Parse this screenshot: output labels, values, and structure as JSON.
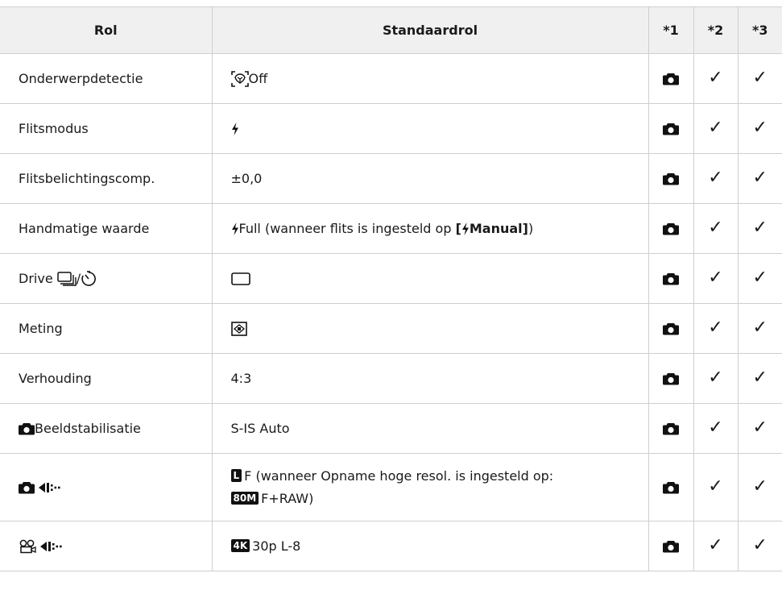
{
  "header": {
    "rol": "Rol",
    "standaard": "Standaardrol",
    "n1": "*1",
    "n2": "*2",
    "n3": "*3"
  },
  "check": "✓",
  "rows": [
    {
      "rol": "Onderwerpdetectie",
      "value": "Off"
    },
    {
      "rol": "Flitsmodus",
      "value": ""
    },
    {
      "rol": "Flitsbelichtingscomp.",
      "value": "±0,0"
    },
    {
      "rol": "Handmatige waarde",
      "value_pre": "Full (wanneer flits is ingesteld op ",
      "value_bold": "[",
      "value_bold2": "Manual]",
      "value_post": ")"
    },
    {
      "rol": "Drive ",
      "rol_sep": "/",
      "value": ""
    },
    {
      "rol": "Meting",
      "value": ""
    },
    {
      "rol": "Verhouding",
      "value": "4:3"
    },
    {
      "rol": "Beeldstabilisatie",
      "value": "S-IS Auto"
    },
    {
      "rol": "",
      "value_pre": "F (wanneer Opname hoge resol. is ingesteld op:",
      "badge": "80M",
      "value_post": "F+RAW)"
    },
    {
      "rol": "",
      "badge": "4K",
      "value": "30p L-8"
    }
  ]
}
